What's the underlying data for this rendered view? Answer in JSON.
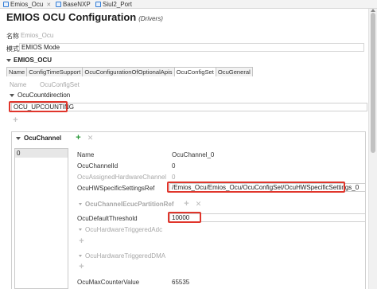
{
  "file_tabs": [
    {
      "label": "Emios_Ocu"
    },
    {
      "label": "BaseNXP"
    },
    {
      "label": "Siul2_Port"
    }
  ],
  "header": {
    "title": "EMIOS OCU Configuration",
    "subtitle": "(Drivers)"
  },
  "meta": {
    "name_label": "名称",
    "name_value": "Emios_Ocu",
    "mode_label": "模式",
    "mode_value": "EMIOS Mode"
  },
  "section": {
    "label": "EMIOS_OCU"
  },
  "subtabs": [
    "Name",
    "ConfigTimeSupport",
    "OcuConfigurationOfOptionalApis",
    "OcuConfigSet",
    "OcuGeneral"
  ],
  "config_set": {
    "name_label": "Name",
    "name_value": "OcuConfigSet",
    "countdirection_label": "OcuCountdirection",
    "countdirection_value": "OCU_UPCOUNTING"
  },
  "channel_section": {
    "label": "OcuChannel",
    "list_items": [
      "0"
    ]
  },
  "channel": {
    "name_label": "Name",
    "name_value": "OcuChannel_0",
    "channel_id_label": "OcuChannelId",
    "channel_id_value": "0",
    "assigned_hw_label": "OcuAssignedHardwareChannel",
    "assigned_hw_value": "0",
    "hw_specific_label": "OcuHWSpecificSettingsRef",
    "hw_specific_value": "/Emios_Ocu/Emios_Ocu/OcuConfigSet/OcuHWSpecificSettings_0",
    "ecuc_partition_label": "OcuChannelEcucPartitionRef",
    "default_threshold_label": "OcuDefaultThreshold",
    "default_threshold_value": "10000",
    "hw_triggered_adc_label": "OcuHardwareTriggeredAdc",
    "hw_triggered_dma_label": "OcuHardwareTriggeredDMA",
    "max_counter_label": "OcuMaxCounterValue",
    "max_counter_value": "65535"
  },
  "colors": {
    "highlight": "#e0352b",
    "add_green": "#2c9a3c",
    "accent_blue": "#2f7bd6"
  }
}
